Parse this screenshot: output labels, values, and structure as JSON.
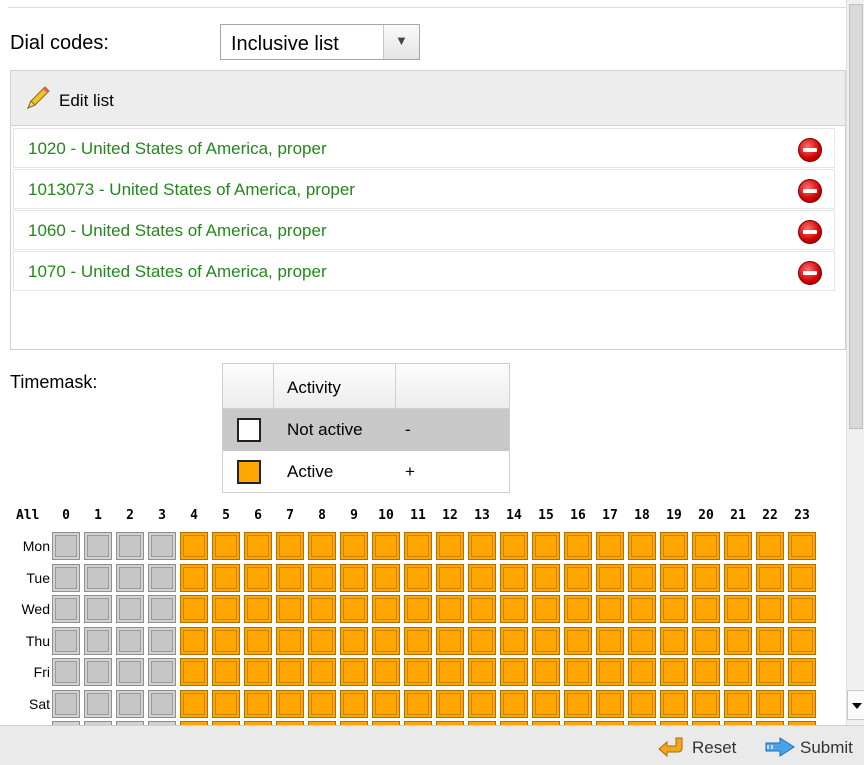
{
  "dial_codes": {
    "label": "Dial codes:",
    "selected": "Inclusive list"
  },
  "list": {
    "edit_label": "Edit list",
    "items": [
      "1020 - United States of America, proper",
      "1013073 - United States of America, proper",
      "1060 - United States of America, proper",
      "1070 - United States of America, proper"
    ]
  },
  "timemask": {
    "label": "Timemask:",
    "legend": {
      "header": "Activity",
      "rows": [
        {
          "name": "Not active",
          "symbol": "-",
          "color": "#ffffff"
        },
        {
          "name": "Active",
          "symbol": "+",
          "color": "#ffa500"
        }
      ]
    },
    "all_label": "All",
    "hours": [
      "0",
      "1",
      "2",
      "3",
      "4",
      "5",
      "6",
      "7",
      "8",
      "9",
      "10",
      "11",
      "12",
      "13",
      "14",
      "15",
      "16",
      "17",
      "18",
      "19",
      "20",
      "21",
      "22",
      "23"
    ],
    "days": [
      "Mon",
      "Tue",
      "Wed",
      "Thu",
      "Fri",
      "Sat"
    ],
    "active_from_hour": 4,
    "colors": {
      "active": "#ffa500",
      "inactive": "#d2d2d2"
    }
  },
  "footer": {
    "reset_label": "Reset",
    "submit_label": "Submit"
  }
}
